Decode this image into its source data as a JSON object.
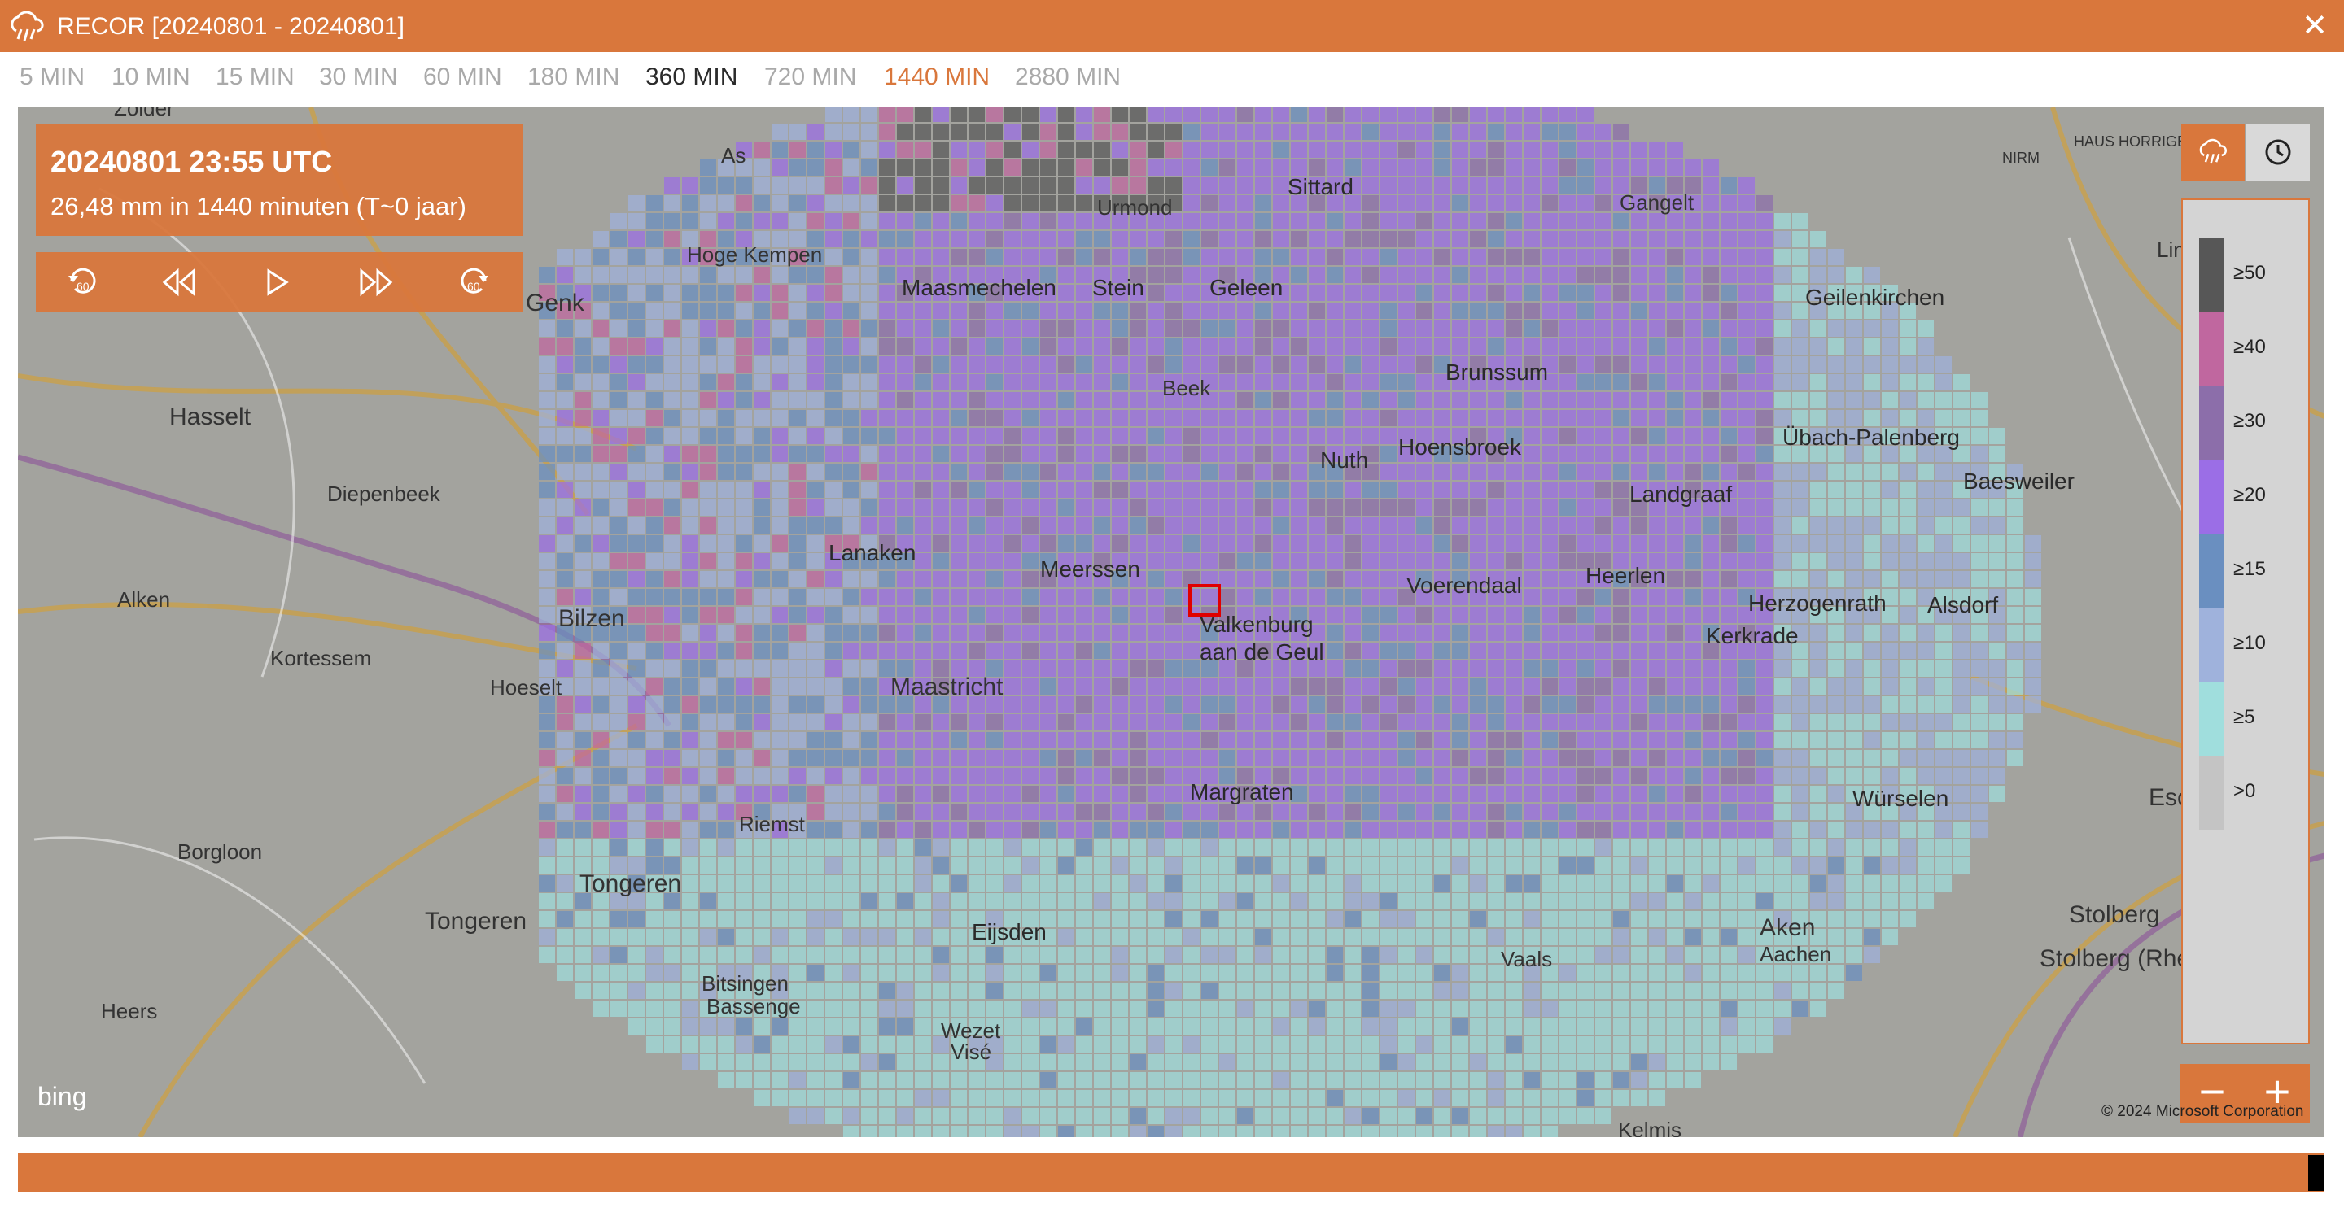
{
  "window": {
    "title": "RECOR [20240801 - 20240801]",
    "close_label": "✕"
  },
  "intervals": [
    {
      "label": "5 MIN",
      "state": "inactive"
    },
    {
      "label": "10 MIN",
      "state": "inactive"
    },
    {
      "label": "15 MIN",
      "state": "inactive"
    },
    {
      "label": "30 MIN",
      "state": "inactive"
    },
    {
      "label": "60 MIN",
      "state": "inactive"
    },
    {
      "label": "180 MIN",
      "state": "inactive"
    },
    {
      "label": "360 MIN",
      "state": "active"
    },
    {
      "label": "720 MIN",
      "state": "inactive"
    },
    {
      "label": "1440 MIN",
      "state": "selected"
    },
    {
      "label": "2880 MIN",
      "state": "inactive"
    }
  ],
  "info": {
    "time": "20240801 23:55 UTC",
    "description": "26,48 mm in 1440 minuten (T~0 jaar)"
  },
  "controls": {
    "items": [
      {
        "icon": "rewind-60-icon",
        "label": "60"
      },
      {
        "icon": "fast-backward-icon"
      },
      {
        "icon": "play-icon"
      },
      {
        "icon": "fast-forward-icon"
      },
      {
        "icon": "forward-60-icon",
        "label": "60"
      }
    ]
  },
  "side_buttons": [
    {
      "icon": "rain-cloud-icon",
      "active": true
    },
    {
      "icon": "clock-icon",
      "active": false
    }
  ],
  "legend": {
    "items": [
      {
        "label": "≥50",
        "color": "#575757"
      },
      {
        "label": "≥40",
        "color": "#c0679f"
      },
      {
        "label": "≥30",
        "color": "#8c6eaa"
      },
      {
        "label": "≥20",
        "color": "#9b6ee6"
      },
      {
        "label": "≥15",
        "color": "#6a8fc0"
      },
      {
        "label": "≥10",
        "color": "#9fb2dc"
      },
      {
        "label": "≥5",
        "color": "#a0dedd"
      },
      {
        "label": ">0",
        "color": "#c4c4c4"
      }
    ]
  },
  "zoom": {
    "minus": "−",
    "plus": "+"
  },
  "map": {
    "attribution": "© 2024 Microsoft Corporation",
    "provider": "bing",
    "places": [
      {
        "name": "Zolder"
      },
      {
        "name": "As"
      },
      {
        "name": "Urmond"
      },
      {
        "name": "Sittard"
      },
      {
        "name": "Gangelt"
      },
      {
        "name": "Genk"
      },
      {
        "name": "Hoge Kempen"
      },
      {
        "name": "Maasmechelen"
      },
      {
        "name": "Stein"
      },
      {
        "name": "Geleen"
      },
      {
        "name": "Geilenkirchen"
      },
      {
        "name": "Hasselt"
      },
      {
        "name": "Beek"
      },
      {
        "name": "Brunssum"
      },
      {
        "name": "Übach-Palenberg"
      },
      {
        "name": "Diepenbeek"
      },
      {
        "name": "Nuth"
      },
      {
        "name": "Hoensbroek"
      },
      {
        "name": "Baesweiler"
      },
      {
        "name": "Landgraaf"
      },
      {
        "name": "Lanaken"
      },
      {
        "name": "Meerssen"
      },
      {
        "name": "Voerendaal"
      },
      {
        "name": "Heerlen"
      },
      {
        "name": "Alken"
      },
      {
        "name": "Bilzen"
      },
      {
        "name": "Valkenburg"
      },
      {
        "name": "aan de Geul"
      },
      {
        "name": "Herzogenrath"
      },
      {
        "name": "Alsdorf"
      },
      {
        "name": "Kortessem"
      },
      {
        "name": "Kerkrade"
      },
      {
        "name": "Hoeselt"
      },
      {
        "name": "Maastricht"
      },
      {
        "name": "Margraten"
      },
      {
        "name": "Würselen"
      },
      {
        "name": "Riemst"
      },
      {
        "name": "Borgloon"
      },
      {
        "name": "Tongeren"
      },
      {
        "name": "Eijsden"
      },
      {
        "name": "Aken"
      },
      {
        "name": "Aachen"
      },
      {
        "name": "Stolberg"
      },
      {
        "name": "Stolberg (Rheinland)"
      },
      {
        "name": "Bitsingen"
      },
      {
        "name": "Bassenge"
      },
      {
        "name": "Vaals"
      },
      {
        "name": "Heers"
      },
      {
        "name": "Wezet"
      },
      {
        "name": "Visé"
      },
      {
        "name": "Kelmis"
      },
      {
        "name": "Esch"
      },
      {
        "name": "Lin"
      },
      {
        "name": "NIRM"
      },
      {
        "name": "HAUS HORRIGEN"
      }
    ]
  }
}
